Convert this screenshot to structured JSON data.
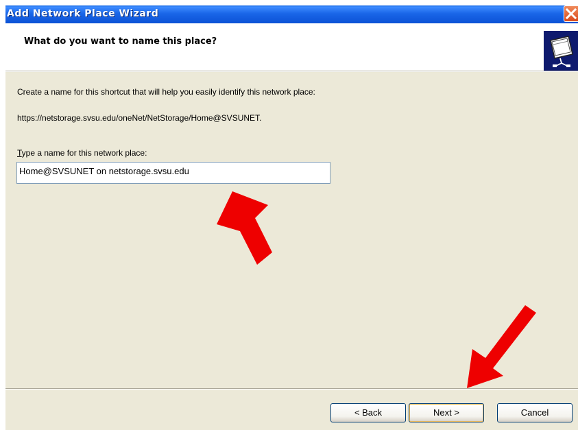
{
  "window": {
    "title": "Add Network Place Wizard"
  },
  "header": {
    "title": "What do you want to name this place?",
    "icon": "network-place-icon"
  },
  "content": {
    "description": "Create a name for this shortcut that will help you easily identify this network place:",
    "url": "https://netstorage.svsu.edu/oneNet/NetStorage/Home@SVSUNET.",
    "field_label_accesskey": "T",
    "field_label_rest": "ype a name for this network place:",
    "name_value": "Home@SVSUNET on netstorage.svsu.edu"
  },
  "buttons": {
    "back_label": "< Back",
    "next_label": "Next >",
    "cancel_label": "Cancel"
  },
  "colors": {
    "titlebar": "#0b52d6",
    "dialog_bg": "#ece9d8",
    "annotation_arrow": "#ee0000"
  },
  "annotations": [
    {
      "name": "arrow-to-name-field",
      "points_to": "name-input"
    },
    {
      "name": "arrow-to-next-button",
      "points_to": "next-button"
    }
  ]
}
